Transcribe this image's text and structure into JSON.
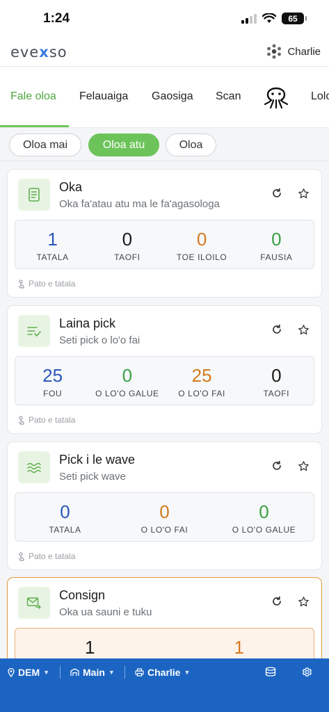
{
  "status_bar": {
    "time": "1:24",
    "battery": "65"
  },
  "header": {
    "logo_left": "eve",
    "logo_x": "x",
    "logo_right": "so",
    "user": "Charlie"
  },
  "nav": {
    "tabs": [
      "Fale oloa",
      "Felauaiga",
      "Gaosiga",
      "Scan",
      "Lolo"
    ],
    "active": "Fale oloa"
  },
  "segments": [
    "Oloa mai",
    "Oloa atu",
    "Oloa"
  ],
  "cards": [
    {
      "title": "Oka",
      "subtitle": "Oka fa'atau atu ma le fa'agasologa",
      "footer": "Pato e tatala",
      "stats": [
        {
          "value": "1",
          "label": "TATALA"
        },
        {
          "value": "0",
          "label": "TAOFI"
        },
        {
          "value": "0",
          "label": "TOE ILOILO"
        },
        {
          "value": "0",
          "label": "FAUSIA"
        }
      ]
    },
    {
      "title": "Laina pick",
      "subtitle": "Seti pick o lo'o fai",
      "footer": "Pato e tatala",
      "stats": [
        {
          "value": "25",
          "label": "FOU"
        },
        {
          "value": "0",
          "label": "O LO'O GALUE"
        },
        {
          "value": "25",
          "label": "O LO'O FAI"
        },
        {
          "value": "0",
          "label": "TAOFI"
        }
      ]
    },
    {
      "title": "Pick i le wave",
      "subtitle": "Seti pick wave",
      "footer": "Pato e tatala",
      "stats": [
        {
          "value": "0",
          "label": "TATALA"
        },
        {
          "value": "0",
          "label": "O LO'O FAI"
        },
        {
          "value": "0",
          "label": "O LO'O GALUE"
        }
      ]
    },
    {
      "title": "Consign",
      "subtitle": "Oka ua sauni e tuku",
      "stats": [
        {
          "value": "1",
          "label": ""
        },
        {
          "value": "1",
          "label": ""
        }
      ]
    }
  ],
  "bottom_bar": {
    "location": "DEM",
    "warehouse": "Main",
    "printer": "Charlie"
  },
  "colors": {
    "accent_green": "#6cc35a",
    "bottom_bar_blue": "#1b64c2",
    "stat_blue": "#2c56b8",
    "stat_orange": "#d47a1e",
    "stat_green": "#3aa046"
  }
}
